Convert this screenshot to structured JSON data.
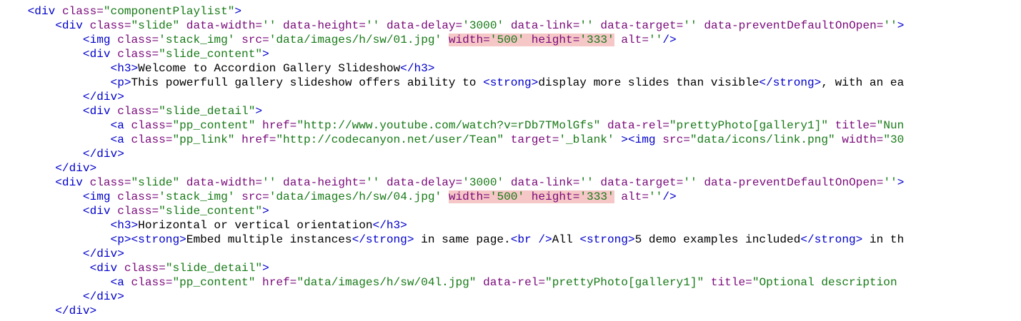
{
  "colors": {
    "tag": "#0000cc",
    "attribute": "#7a0a7a",
    "value": "#187a18",
    "text": "#000000",
    "highlight": "#f6c7c7"
  },
  "lines": [
    {
      "indent": 1,
      "tokens": [
        {
          "t": "tag",
          "v": "<div "
        },
        {
          "t": "attr",
          "v": "class="
        },
        {
          "t": "val",
          "v": "\"componentPlaylist\""
        },
        {
          "t": "tag",
          "v": ">"
        }
      ]
    },
    {
      "indent": 2,
      "tokens": [
        {
          "t": "tag",
          "v": "<div "
        },
        {
          "t": "attr",
          "v": "class="
        },
        {
          "t": "val",
          "v": "\"slide\""
        },
        {
          "t": "text",
          "v": " "
        },
        {
          "t": "attr",
          "v": "data-width="
        },
        {
          "t": "val",
          "v": "''"
        },
        {
          "t": "text",
          "v": " "
        },
        {
          "t": "attr",
          "v": "data-height="
        },
        {
          "t": "val",
          "v": "''"
        },
        {
          "t": "text",
          "v": " "
        },
        {
          "t": "attr",
          "v": "data-delay="
        },
        {
          "t": "val",
          "v": "'3000'"
        },
        {
          "t": "text",
          "v": " "
        },
        {
          "t": "attr",
          "v": "data-link="
        },
        {
          "t": "val",
          "v": "''"
        },
        {
          "t": "text",
          "v": " "
        },
        {
          "t": "attr",
          "v": "data-target="
        },
        {
          "t": "val",
          "v": "''"
        },
        {
          "t": "text",
          "v": " "
        },
        {
          "t": "attr",
          "v": "data-preventDefaultOnOpen="
        },
        {
          "t": "val",
          "v": "''"
        },
        {
          "t": "tag",
          "v": ">"
        }
      ]
    },
    {
      "indent": 3,
      "tokens": [
        {
          "t": "tag",
          "v": "<img "
        },
        {
          "t": "attr",
          "v": "class="
        },
        {
          "t": "val",
          "v": "'stack_img'"
        },
        {
          "t": "text",
          "v": " "
        },
        {
          "t": "attr",
          "v": "src="
        },
        {
          "t": "val",
          "v": "'data/images/h/sw/01.jpg'"
        },
        {
          "t": "text",
          "v": " "
        },
        {
          "t": "attr",
          "v": "width=",
          "hl": true
        },
        {
          "t": "val",
          "v": "'500'",
          "hl": true
        },
        {
          "t": "text",
          "v": " ",
          "hl": true
        },
        {
          "t": "attr",
          "v": "height=",
          "hl": true
        },
        {
          "t": "val",
          "v": "'333'",
          "hl": true
        },
        {
          "t": "text",
          "v": " "
        },
        {
          "t": "attr",
          "v": "alt="
        },
        {
          "t": "val",
          "v": "''"
        },
        {
          "t": "tag",
          "v": "/>"
        }
      ]
    },
    {
      "indent": 3,
      "tokens": [
        {
          "t": "tag",
          "v": "<div "
        },
        {
          "t": "attr",
          "v": "class="
        },
        {
          "t": "val",
          "v": "\"slide_content\""
        },
        {
          "t": "tag",
          "v": ">"
        }
      ]
    },
    {
      "indent": 4,
      "tokens": [
        {
          "t": "tag",
          "v": "<h3>"
        },
        {
          "t": "text",
          "v": "Welcome to Accordion Gallery Slideshow"
        },
        {
          "t": "tag",
          "v": "</h3>"
        }
      ]
    },
    {
      "indent": 4,
      "tokens": [
        {
          "t": "tag",
          "v": "<p>"
        },
        {
          "t": "text",
          "v": "This powerfull gallery slideshow offers ability to "
        },
        {
          "t": "tag",
          "v": "<strong>"
        },
        {
          "t": "text",
          "v": "display more slides than visible"
        },
        {
          "t": "tag",
          "v": "</strong>"
        },
        {
          "t": "text",
          "v": ", with an ea"
        }
      ]
    },
    {
      "indent": 3,
      "tokens": [
        {
          "t": "tag",
          "v": "</div>"
        }
      ]
    },
    {
      "indent": 3,
      "tokens": [
        {
          "t": "tag",
          "v": "<div "
        },
        {
          "t": "attr",
          "v": "class="
        },
        {
          "t": "val",
          "v": "\"slide_detail\""
        },
        {
          "t": "tag",
          "v": ">"
        }
      ]
    },
    {
      "indent": 4,
      "tokens": [
        {
          "t": "tag",
          "v": "<a "
        },
        {
          "t": "attr",
          "v": "class="
        },
        {
          "t": "val",
          "v": "\"pp_content\""
        },
        {
          "t": "text",
          "v": " "
        },
        {
          "t": "attr",
          "v": "href="
        },
        {
          "t": "val",
          "v": "\"http://www.youtube.com/watch?v=rDb7TMolGfs\""
        },
        {
          "t": "text",
          "v": " "
        },
        {
          "t": "attr",
          "v": "data-rel="
        },
        {
          "t": "val",
          "v": "\"prettyPhoto[gallery1]\""
        },
        {
          "t": "text",
          "v": " "
        },
        {
          "t": "attr",
          "v": "title="
        },
        {
          "t": "val",
          "v": "\"Nun"
        }
      ]
    },
    {
      "indent": 4,
      "tokens": [
        {
          "t": "tag",
          "v": "<a "
        },
        {
          "t": "attr",
          "v": "class="
        },
        {
          "t": "val",
          "v": "\"pp_link\""
        },
        {
          "t": "text",
          "v": " "
        },
        {
          "t": "attr",
          "v": "href="
        },
        {
          "t": "val",
          "v": "\"http://codecanyon.net/user/Tean\""
        },
        {
          "t": "text",
          "v": " "
        },
        {
          "t": "attr",
          "v": "target="
        },
        {
          "t": "val",
          "v": "'_blank'"
        },
        {
          "t": "text",
          "v": " "
        },
        {
          "t": "tag",
          "v": "><img "
        },
        {
          "t": "attr",
          "v": "src="
        },
        {
          "t": "val",
          "v": "\"data/icons/link.png\""
        },
        {
          "t": "text",
          "v": " "
        },
        {
          "t": "attr",
          "v": "width="
        },
        {
          "t": "val",
          "v": "\"30"
        }
      ]
    },
    {
      "indent": 3,
      "tokens": [
        {
          "t": "tag",
          "v": "</div>"
        }
      ]
    },
    {
      "indent": 2,
      "tokens": [
        {
          "t": "tag",
          "v": "</div>"
        }
      ]
    },
    {
      "indent": 2,
      "tokens": [
        {
          "t": "tag",
          "v": "<div "
        },
        {
          "t": "attr",
          "v": "class="
        },
        {
          "t": "val",
          "v": "\"slide\""
        },
        {
          "t": "text",
          "v": " "
        },
        {
          "t": "attr",
          "v": "data-width="
        },
        {
          "t": "val",
          "v": "''"
        },
        {
          "t": "text",
          "v": " "
        },
        {
          "t": "attr",
          "v": "data-height="
        },
        {
          "t": "val",
          "v": "''"
        },
        {
          "t": "text",
          "v": " "
        },
        {
          "t": "attr",
          "v": "data-delay="
        },
        {
          "t": "val",
          "v": "'3000'"
        },
        {
          "t": "text",
          "v": " "
        },
        {
          "t": "attr",
          "v": "data-link="
        },
        {
          "t": "val",
          "v": "''"
        },
        {
          "t": "text",
          "v": " "
        },
        {
          "t": "attr",
          "v": "data-target="
        },
        {
          "t": "val",
          "v": "''"
        },
        {
          "t": "text",
          "v": " "
        },
        {
          "t": "attr",
          "v": "data-preventDefaultOnOpen="
        },
        {
          "t": "val",
          "v": "''"
        },
        {
          "t": "tag",
          "v": ">"
        }
      ]
    },
    {
      "indent": 3,
      "tokens": [
        {
          "t": "tag",
          "v": "<img "
        },
        {
          "t": "attr",
          "v": "class="
        },
        {
          "t": "val",
          "v": "'stack_img'"
        },
        {
          "t": "text",
          "v": " "
        },
        {
          "t": "attr",
          "v": "src="
        },
        {
          "t": "val",
          "v": "'data/images/h/sw/04.jpg'"
        },
        {
          "t": "text",
          "v": " "
        },
        {
          "t": "attr",
          "v": "width=",
          "hl": true
        },
        {
          "t": "val",
          "v": "'500'",
          "hl": true
        },
        {
          "t": "text",
          "v": " ",
          "hl": true
        },
        {
          "t": "attr",
          "v": "height=",
          "hl": true
        },
        {
          "t": "val",
          "v": "'333'",
          "hl": true
        },
        {
          "t": "text",
          "v": " "
        },
        {
          "t": "attr",
          "v": "alt="
        },
        {
          "t": "val",
          "v": "''"
        },
        {
          "t": "tag",
          "v": "/>"
        }
      ]
    },
    {
      "indent": 3,
      "tokens": [
        {
          "t": "tag",
          "v": "<div "
        },
        {
          "t": "attr",
          "v": "class="
        },
        {
          "t": "val",
          "v": "\"slide_content\""
        },
        {
          "t": "tag",
          "v": ">"
        }
      ]
    },
    {
      "indent": 4,
      "tokens": [
        {
          "t": "tag",
          "v": "<h3>"
        },
        {
          "t": "text",
          "v": "Horizontal or vertical orientation"
        },
        {
          "t": "tag",
          "v": "</h3>"
        }
      ]
    },
    {
      "indent": 4,
      "tokens": [
        {
          "t": "tag",
          "v": "<p><strong>"
        },
        {
          "t": "text",
          "v": "Embed multiple instances"
        },
        {
          "t": "tag",
          "v": "</strong>"
        },
        {
          "t": "text",
          "v": " in same page."
        },
        {
          "t": "tag",
          "v": "<br />"
        },
        {
          "t": "text",
          "v": "All "
        },
        {
          "t": "tag",
          "v": "<strong>"
        },
        {
          "t": "text",
          "v": "5 demo examples included"
        },
        {
          "t": "tag",
          "v": "</strong>"
        },
        {
          "t": "text",
          "v": " in th"
        }
      ]
    },
    {
      "indent": 3,
      "tokens": [
        {
          "t": "tag",
          "v": "</div>"
        }
      ]
    },
    {
      "indent": 3,
      "lead": " ",
      "tokens": [
        {
          "t": "tag",
          "v": "<div "
        },
        {
          "t": "attr",
          "v": "class="
        },
        {
          "t": "val",
          "v": "\"slide_detail\""
        },
        {
          "t": "tag",
          "v": ">"
        }
      ]
    },
    {
      "indent": 4,
      "tokens": [
        {
          "t": "tag",
          "v": "<a "
        },
        {
          "t": "attr",
          "v": "class="
        },
        {
          "t": "val",
          "v": "\"pp_content\""
        },
        {
          "t": "text",
          "v": " "
        },
        {
          "t": "attr",
          "v": "href="
        },
        {
          "t": "val",
          "v": "\"data/images/h/sw/04l.jpg\""
        },
        {
          "t": "text",
          "v": " "
        },
        {
          "t": "attr",
          "v": "data-rel="
        },
        {
          "t": "val",
          "v": "\"prettyPhoto[gallery1]\""
        },
        {
          "t": "text",
          "v": " "
        },
        {
          "t": "attr",
          "v": "title="
        },
        {
          "t": "val",
          "v": "\"Optional description"
        }
      ]
    },
    {
      "indent": 3,
      "tokens": [
        {
          "t": "tag",
          "v": "</div>"
        }
      ]
    },
    {
      "indent": 2,
      "tokens": [
        {
          "t": "tag",
          "v": "</div>"
        }
      ]
    }
  ]
}
